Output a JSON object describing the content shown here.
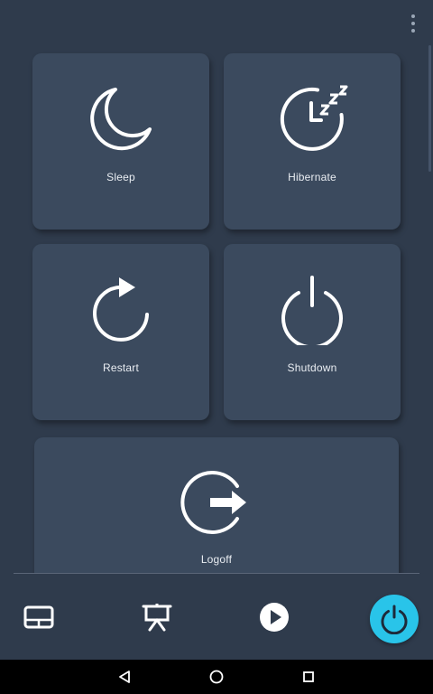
{
  "colors": {
    "background": "#2f3b4c",
    "tile": "#3b4a5e",
    "accent": "#29c4e9",
    "icon": "#ffffff"
  },
  "toolbar": {
    "overflow_icon": "more-vert-icon"
  },
  "tiles": [
    {
      "label": "Sleep",
      "icon": "moon-icon"
    },
    {
      "label": "Hibernate",
      "icon": "clock-zzz-icon"
    },
    {
      "label": "Restart",
      "icon": "restart-icon"
    },
    {
      "label": "Shutdown",
      "icon": "power-icon"
    },
    {
      "label": "Logoff",
      "icon": "logout-icon"
    }
  ],
  "bottom_nav": [
    {
      "icon": "touchpad-icon"
    },
    {
      "icon": "presentation-icon"
    },
    {
      "icon": "play-circle-icon"
    },
    {
      "icon": "power-icon",
      "active": true
    }
  ],
  "system_nav": [
    {
      "icon": "back-icon"
    },
    {
      "icon": "home-icon"
    },
    {
      "icon": "recents-icon"
    }
  ]
}
